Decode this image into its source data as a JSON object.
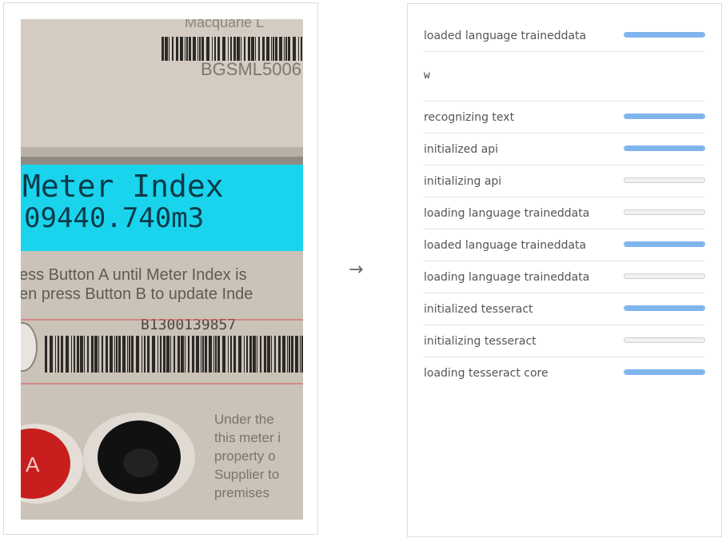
{
  "arrow": "→",
  "photo": {
    "brand_text": "Macquarie L",
    "serial_top": "BGSML5006",
    "display_line1": "Meter Index",
    "display_line2": "09440.740m3",
    "instruction_line1": "ess Button A until Meter Index is",
    "instruction_line2": "en press Button B to update Inde",
    "serial_bottom": "B1300139857",
    "notice_lines": [
      "Under the",
      "this meter i",
      "property o",
      "Supplier to",
      "premises"
    ],
    "button_a_letter": "A",
    "lcd_color": "#19d4ec",
    "red_button_color": "#c81e1e"
  },
  "results": {
    "first_row": {
      "label": "loaded language traineddata",
      "progress": 1
    },
    "ocr_output": "w",
    "rows": [
      {
        "label": "recognizing text",
        "progress": 1
      },
      {
        "label": "initialized api",
        "progress": 1
      },
      {
        "label": "initializing api",
        "progress": 0
      },
      {
        "label": "loading language traineddata",
        "progress": 0
      },
      {
        "label": "loaded language traineddata",
        "progress": 1
      },
      {
        "label": "loading language traineddata",
        "progress": 0
      },
      {
        "label": "initialized tesseract",
        "progress": 1
      },
      {
        "label": "initializing tesseract",
        "progress": 0
      },
      {
        "label": "loading tesseract core",
        "progress": 1
      }
    ],
    "bar_color": "#7fb5ec"
  }
}
